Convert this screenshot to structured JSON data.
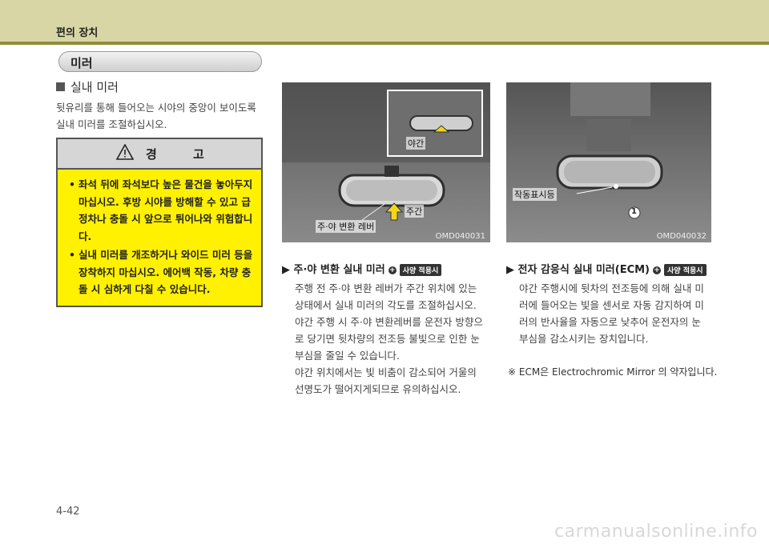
{
  "header": {
    "section": "편의 장치"
  },
  "pill": {
    "label": "미러"
  },
  "interior": {
    "heading": "실내 미러",
    "desc": "뒷유리를 통해 들어오는 시야의 중앙이 보이도록 실내 미러를 조절하십시오."
  },
  "warning": {
    "title": "경 고",
    "items": [
      "좌석 뒤에 좌석보다 높은 물건을 놓아두지 마십시오. 후방 시야를 방해할 수 있고 급정차나 충돌 시 앞으로 튀어나와 위험합니다.",
      "실내 미러를 개조하거나 와이드 미러 등을 장착하지 마십시오. 에어백 작동, 차량 충돌 시 심하게 다칠 수 있습니다."
    ]
  },
  "photo1": {
    "night": "야간",
    "day": "주간",
    "lever": "주·야 변환 레버",
    "id": "OMD040031"
  },
  "photo2": {
    "lamp": "작동표시등",
    "marker": "1",
    "id": "OMD040032"
  },
  "day_night": {
    "title": "주·야 변환  실내 미러",
    "badge": "사양 적용시",
    "body": [
      "주행 전 주·야 변환 레버가 주간 위치에 있는",
      "상태에서 실내 미러의 각도를 조절하십시오.",
      "야간 주행 시 주·야 변환레버를 운전자 방향으",
      "로 당기면 뒷차량의 전조등 불빛으로 인한 눈",
      "부심을 줄일 수 있습니다.",
      "야간 위치에서는 빛 비춤이 감소되어 거울의",
      "선명도가 떨어지게되므로 유의하십시오."
    ]
  },
  "ecm": {
    "title": "전자 감응식 실내 미러(ECM)",
    "badge": "사양 적용시",
    "body": [
      "야간 주행시에 뒷차의 전조등에 의해 실내 미",
      "러에 들어오는 빛을 센서로 자동 감지하여 미",
      "러의 반사율을 자동으로 낮추어 운전자의 눈",
      "부심을 감소시키는 장치입니다."
    ],
    "note": "※  ECM은 Electrochromic Mirror 의 약자입니다."
  },
  "footer": {
    "page": "4-42",
    "watermark": "carmanualsonline.info"
  }
}
